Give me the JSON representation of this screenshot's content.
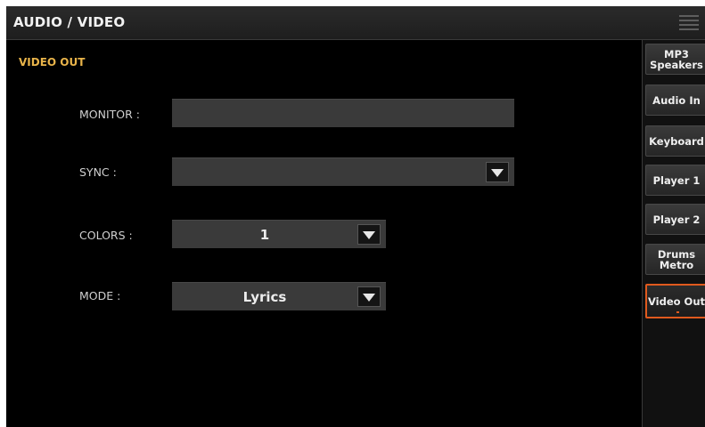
{
  "header": {
    "title": "AUDIO / VIDEO",
    "menu_icon": "hamburger-menu-icon"
  },
  "section": {
    "title": "VIDEO OUT"
  },
  "fields": {
    "monitor": {
      "label": "MONITOR :",
      "value": ""
    },
    "sync": {
      "label": "SYNC :",
      "value": ""
    },
    "colors": {
      "label": "COLORS :",
      "value": "1"
    },
    "mode": {
      "label": "MODE :",
      "value": "Lyrics"
    }
  },
  "tabs": [
    {
      "label": "MP3 Speakers",
      "active": false
    },
    {
      "label": "Audio In",
      "active": false
    },
    {
      "label": "Keyboard",
      "active": false
    },
    {
      "label": "Player 1",
      "active": false
    },
    {
      "label": "Player 2",
      "active": false
    },
    {
      "label": "Drums Metro",
      "active": false
    },
    {
      "label": "Video Out",
      "active": true
    }
  ],
  "colors": {
    "accent": "#e9b44a",
    "active_border": "#e05a1e",
    "field_bg": "#3a3a3a"
  }
}
